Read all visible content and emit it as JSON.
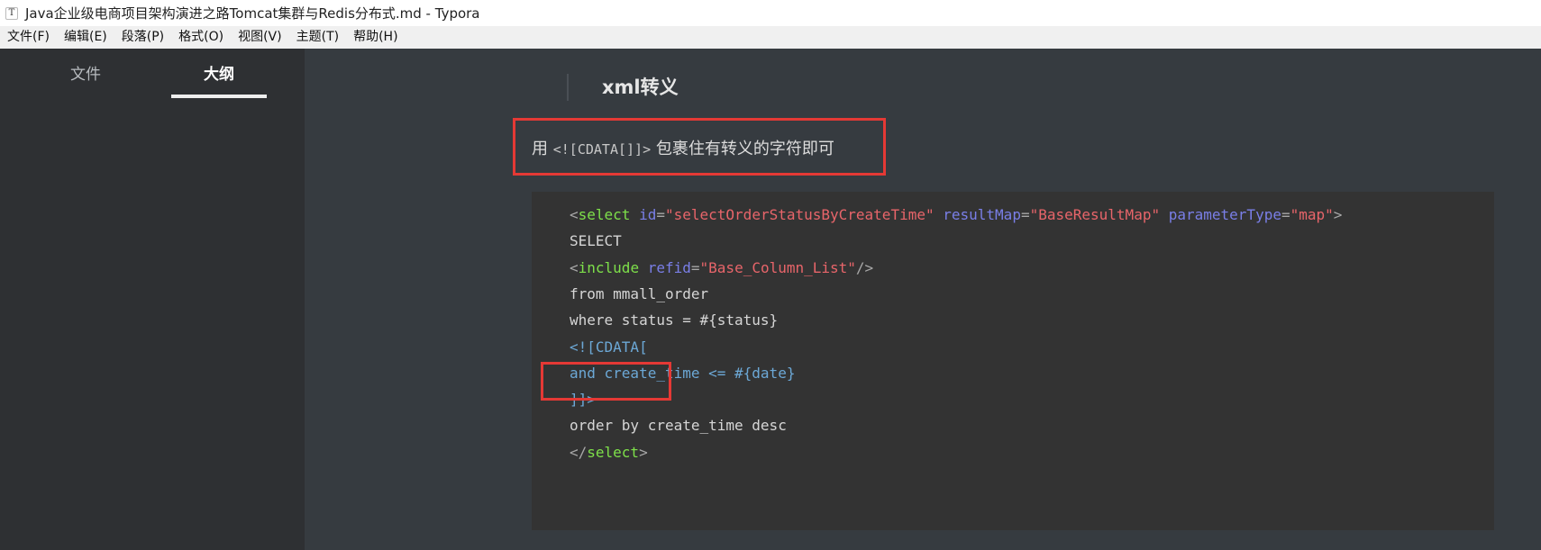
{
  "window": {
    "title": "Java企业级电商项目架构演进之路Tomcat集群与Redis分布式.md - Typora",
    "icon_glyph": "T"
  },
  "menu": [
    "文件(F)",
    "编辑(E)",
    "段落(P)",
    "格式(O)",
    "视图(V)",
    "主题(T)",
    "帮助(H)"
  ],
  "sidebar": {
    "tabs": [
      {
        "label": "文件",
        "active": false
      },
      {
        "label": "大纲",
        "active": true
      }
    ]
  },
  "document": {
    "heading": "xml转义",
    "paragraph": {
      "before": "用 ",
      "code": "<![CDATA[]]>",
      "after": " 包裹住有转义的字符即可"
    },
    "code_lines": [
      [
        {
          "t": "<",
          "c": "punc"
        },
        {
          "t": "select",
          "c": "tag"
        },
        {
          "t": " ",
          "c": "plain"
        },
        {
          "t": "id",
          "c": "attr"
        },
        {
          "t": "=",
          "c": "punc"
        },
        {
          "t": "\"selectOrderStatusByCreateTime\"",
          "c": "str"
        },
        {
          "t": " ",
          "c": "plain"
        },
        {
          "t": "resultMap",
          "c": "attr"
        },
        {
          "t": "=",
          "c": "punc"
        },
        {
          "t": "\"BaseResultMap\"",
          "c": "str"
        },
        {
          "t": " ",
          "c": "plain"
        },
        {
          "t": "parameterType",
          "c": "attr"
        },
        {
          "t": "=",
          "c": "punc"
        },
        {
          "t": "\"map\"",
          "c": "str"
        },
        {
          "t": ">",
          "c": "punc"
        }
      ],
      [
        {
          "t": "SELECT",
          "c": "plain"
        }
      ],
      [
        {
          "t": "<",
          "c": "punc"
        },
        {
          "t": "include",
          "c": "tag"
        },
        {
          "t": " ",
          "c": "plain"
        },
        {
          "t": "refid",
          "c": "attr"
        },
        {
          "t": "=",
          "c": "punc"
        },
        {
          "t": "\"Base_Column_List\"",
          "c": "str"
        },
        {
          "t": "/>",
          "c": "punc"
        }
      ],
      [
        {
          "t": "from mmall_order",
          "c": "plain"
        }
      ],
      [
        {
          "t": "where status = #{status}",
          "c": "plain"
        }
      ],
      [
        {
          "t": "<![CDATA[",
          "c": "cdata"
        }
      ],
      [
        {
          "t": "and create_time <= #{date}",
          "c": "cdata"
        }
      ],
      [
        {
          "t": "]]>",
          "c": "cdata"
        }
      ],
      [
        {
          "t": "order by create_time desc",
          "c": "plain"
        }
      ],
      [
        {
          "t": "</",
          "c": "punc"
        },
        {
          "t": "select",
          "c": "tag"
        },
        {
          "t": ">",
          "c": "punc"
        }
      ]
    ]
  },
  "colors": {
    "highlight_box": "#e53935",
    "xml_tag": "#7ee04a",
    "xml_attr": "#7a7fe8",
    "xml_string": "#e8656a",
    "cdata": "#6ca8d6"
  }
}
